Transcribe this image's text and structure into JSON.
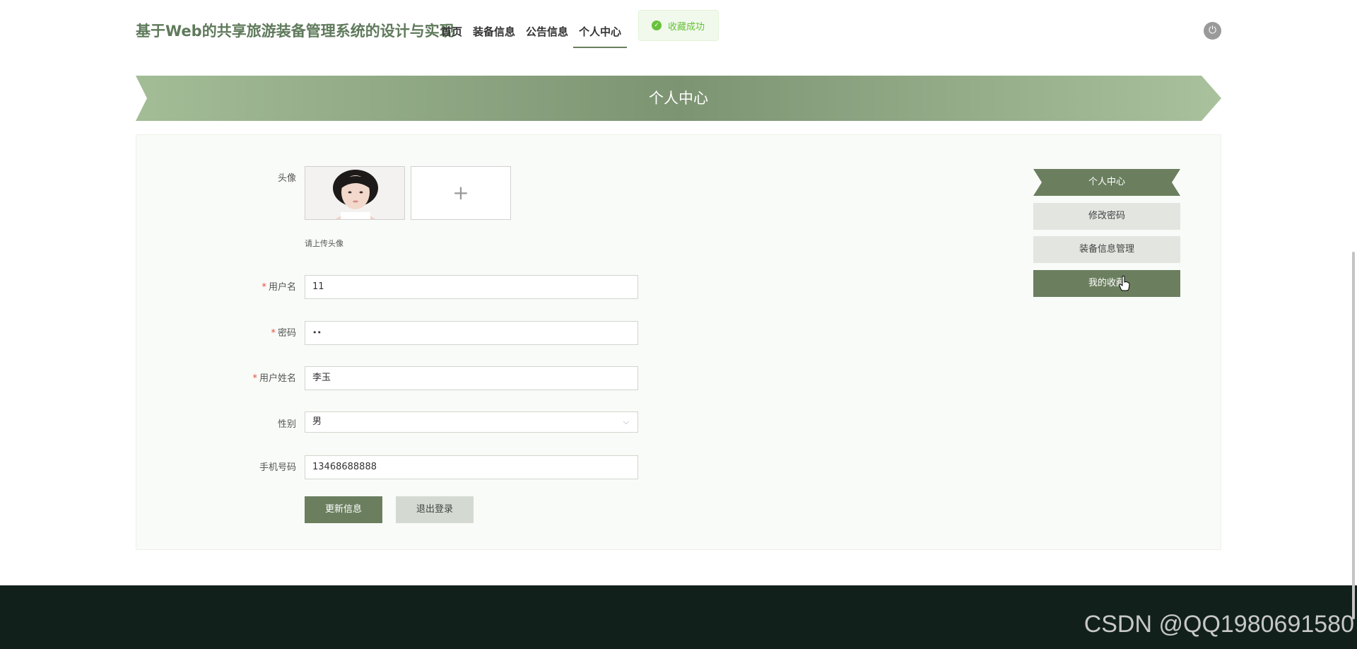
{
  "header": {
    "site_title": "基于Web的共享旅游装备管理系统的设计与实现",
    "nav": [
      {
        "label": "首页"
      },
      {
        "label": "装备信息"
      },
      {
        "label": "公告信息"
      },
      {
        "label": "个人中心"
      }
    ],
    "toast": {
      "icon": "check-circle-icon",
      "message": "收藏成功"
    },
    "power_icon": "power-icon"
  },
  "banner": {
    "title": "个人中心"
  },
  "form": {
    "avatar_label": "头像",
    "upload_hint": "请上传头像",
    "upload_icon": "plus-icon",
    "fields": [
      {
        "label": "用户名",
        "required": "*",
        "value": "11"
      },
      {
        "label": "密码",
        "required": "*",
        "value": "••"
      },
      {
        "label": "用户姓名",
        "required": "*",
        "value": "李玉"
      },
      {
        "label": "性别",
        "required": "",
        "value": "男"
      },
      {
        "label": "手机号码",
        "required": "",
        "value": "13468688888"
      }
    ],
    "update_button": "更新信息",
    "logout_button": "退出登录"
  },
  "side_menu": [
    {
      "label": "个人中心"
    },
    {
      "label": "修改密码"
    },
    {
      "label": "装备信息管理"
    },
    {
      "label": "我的收藏"
    }
  ],
  "footer": {
    "watermark": "CSDN @QQ1980691580"
  },
  "colors": {
    "accent": "#6b7f5f",
    "banner_light": "#a9c29d",
    "footer": "#11201a",
    "success": "#67c23a"
  }
}
